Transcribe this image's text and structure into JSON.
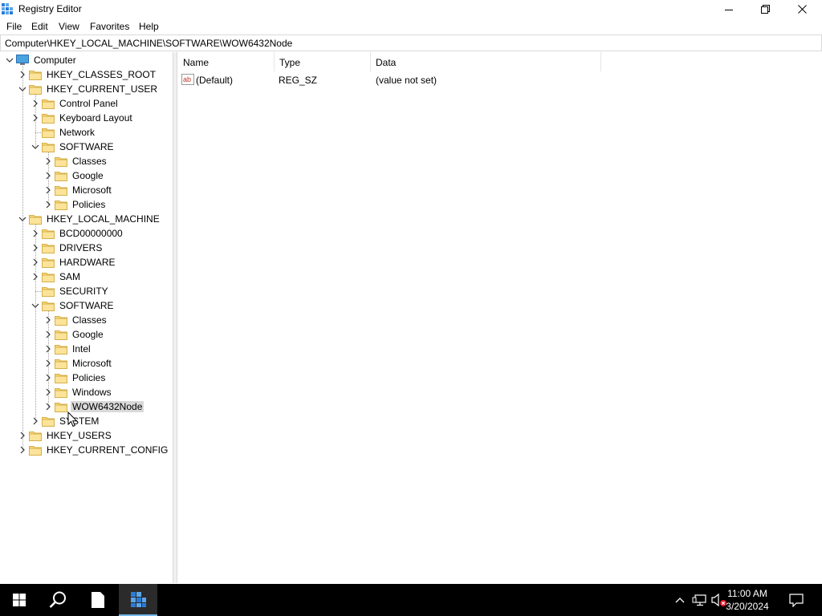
{
  "window": {
    "title": "Registry Editor",
    "minimize_label": "Minimize",
    "restore_label": "Restore",
    "close_label": "Close"
  },
  "menu": {
    "items": [
      "File",
      "Edit",
      "View",
      "Favorites",
      "Help"
    ]
  },
  "address": {
    "path": "Computer\\HKEY_LOCAL_MACHINE\\SOFTWARE\\WOW6432Node"
  },
  "tree": {
    "nodes": [
      {
        "label": "Computer",
        "level": 0,
        "state": "expanded",
        "icon": "computer-icon"
      },
      {
        "label": "HKEY_CLASSES_ROOT",
        "level": 1,
        "state": "collapsed"
      },
      {
        "label": "HKEY_CURRENT_USER",
        "level": 1,
        "state": "expanded"
      },
      {
        "label": "Control Panel",
        "level": 2,
        "state": "collapsed"
      },
      {
        "label": "Keyboard Layout",
        "level": 2,
        "state": "collapsed"
      },
      {
        "label": "Network",
        "level": 2,
        "state": "leaf"
      },
      {
        "label": "SOFTWARE",
        "level": 2,
        "state": "expanded"
      },
      {
        "label": "Classes",
        "level": 3,
        "state": "collapsed"
      },
      {
        "label": "Google",
        "level": 3,
        "state": "collapsed"
      },
      {
        "label": "Microsoft",
        "level": 3,
        "state": "collapsed"
      },
      {
        "label": "Policies",
        "level": 3,
        "state": "collapsed"
      },
      {
        "label": "HKEY_LOCAL_MACHINE",
        "level": 1,
        "state": "expanded"
      },
      {
        "label": "BCD00000000",
        "level": 2,
        "state": "collapsed"
      },
      {
        "label": "DRIVERS",
        "level": 2,
        "state": "collapsed"
      },
      {
        "label": "HARDWARE",
        "level": 2,
        "state": "collapsed"
      },
      {
        "label": "SAM",
        "level": 2,
        "state": "collapsed"
      },
      {
        "label": "SECURITY",
        "level": 2,
        "state": "leaf"
      },
      {
        "label": "SOFTWARE",
        "level": 2,
        "state": "expanded"
      },
      {
        "label": "Classes",
        "level": 3,
        "state": "collapsed"
      },
      {
        "label": "Google",
        "level": 3,
        "state": "collapsed"
      },
      {
        "label": "Intel",
        "level": 3,
        "state": "collapsed"
      },
      {
        "label": "Microsoft",
        "level": 3,
        "state": "collapsed"
      },
      {
        "label": "Policies",
        "level": 3,
        "state": "collapsed"
      },
      {
        "label": "Windows",
        "level": 3,
        "state": "collapsed"
      },
      {
        "label": "WOW6432Node",
        "level": 3,
        "state": "collapsed",
        "selected": true
      },
      {
        "label": "SYSTEM",
        "level": 2,
        "state": "collapsed"
      },
      {
        "label": "HKEY_USERS",
        "level": 1,
        "state": "collapsed"
      },
      {
        "label": "HKEY_CURRENT_CONFIG",
        "level": 1,
        "state": "collapsed"
      }
    ]
  },
  "list": {
    "columns": [
      "Name",
      "Type",
      "Data"
    ],
    "rows": [
      {
        "name": "(Default)",
        "type": "REG_SZ",
        "data": "(value not set)",
        "icon": "string-value-icon"
      }
    ]
  },
  "taskbar": {
    "time": "11:00 AM",
    "date": "3/20/2024",
    "accent": "#76b9ed"
  }
}
